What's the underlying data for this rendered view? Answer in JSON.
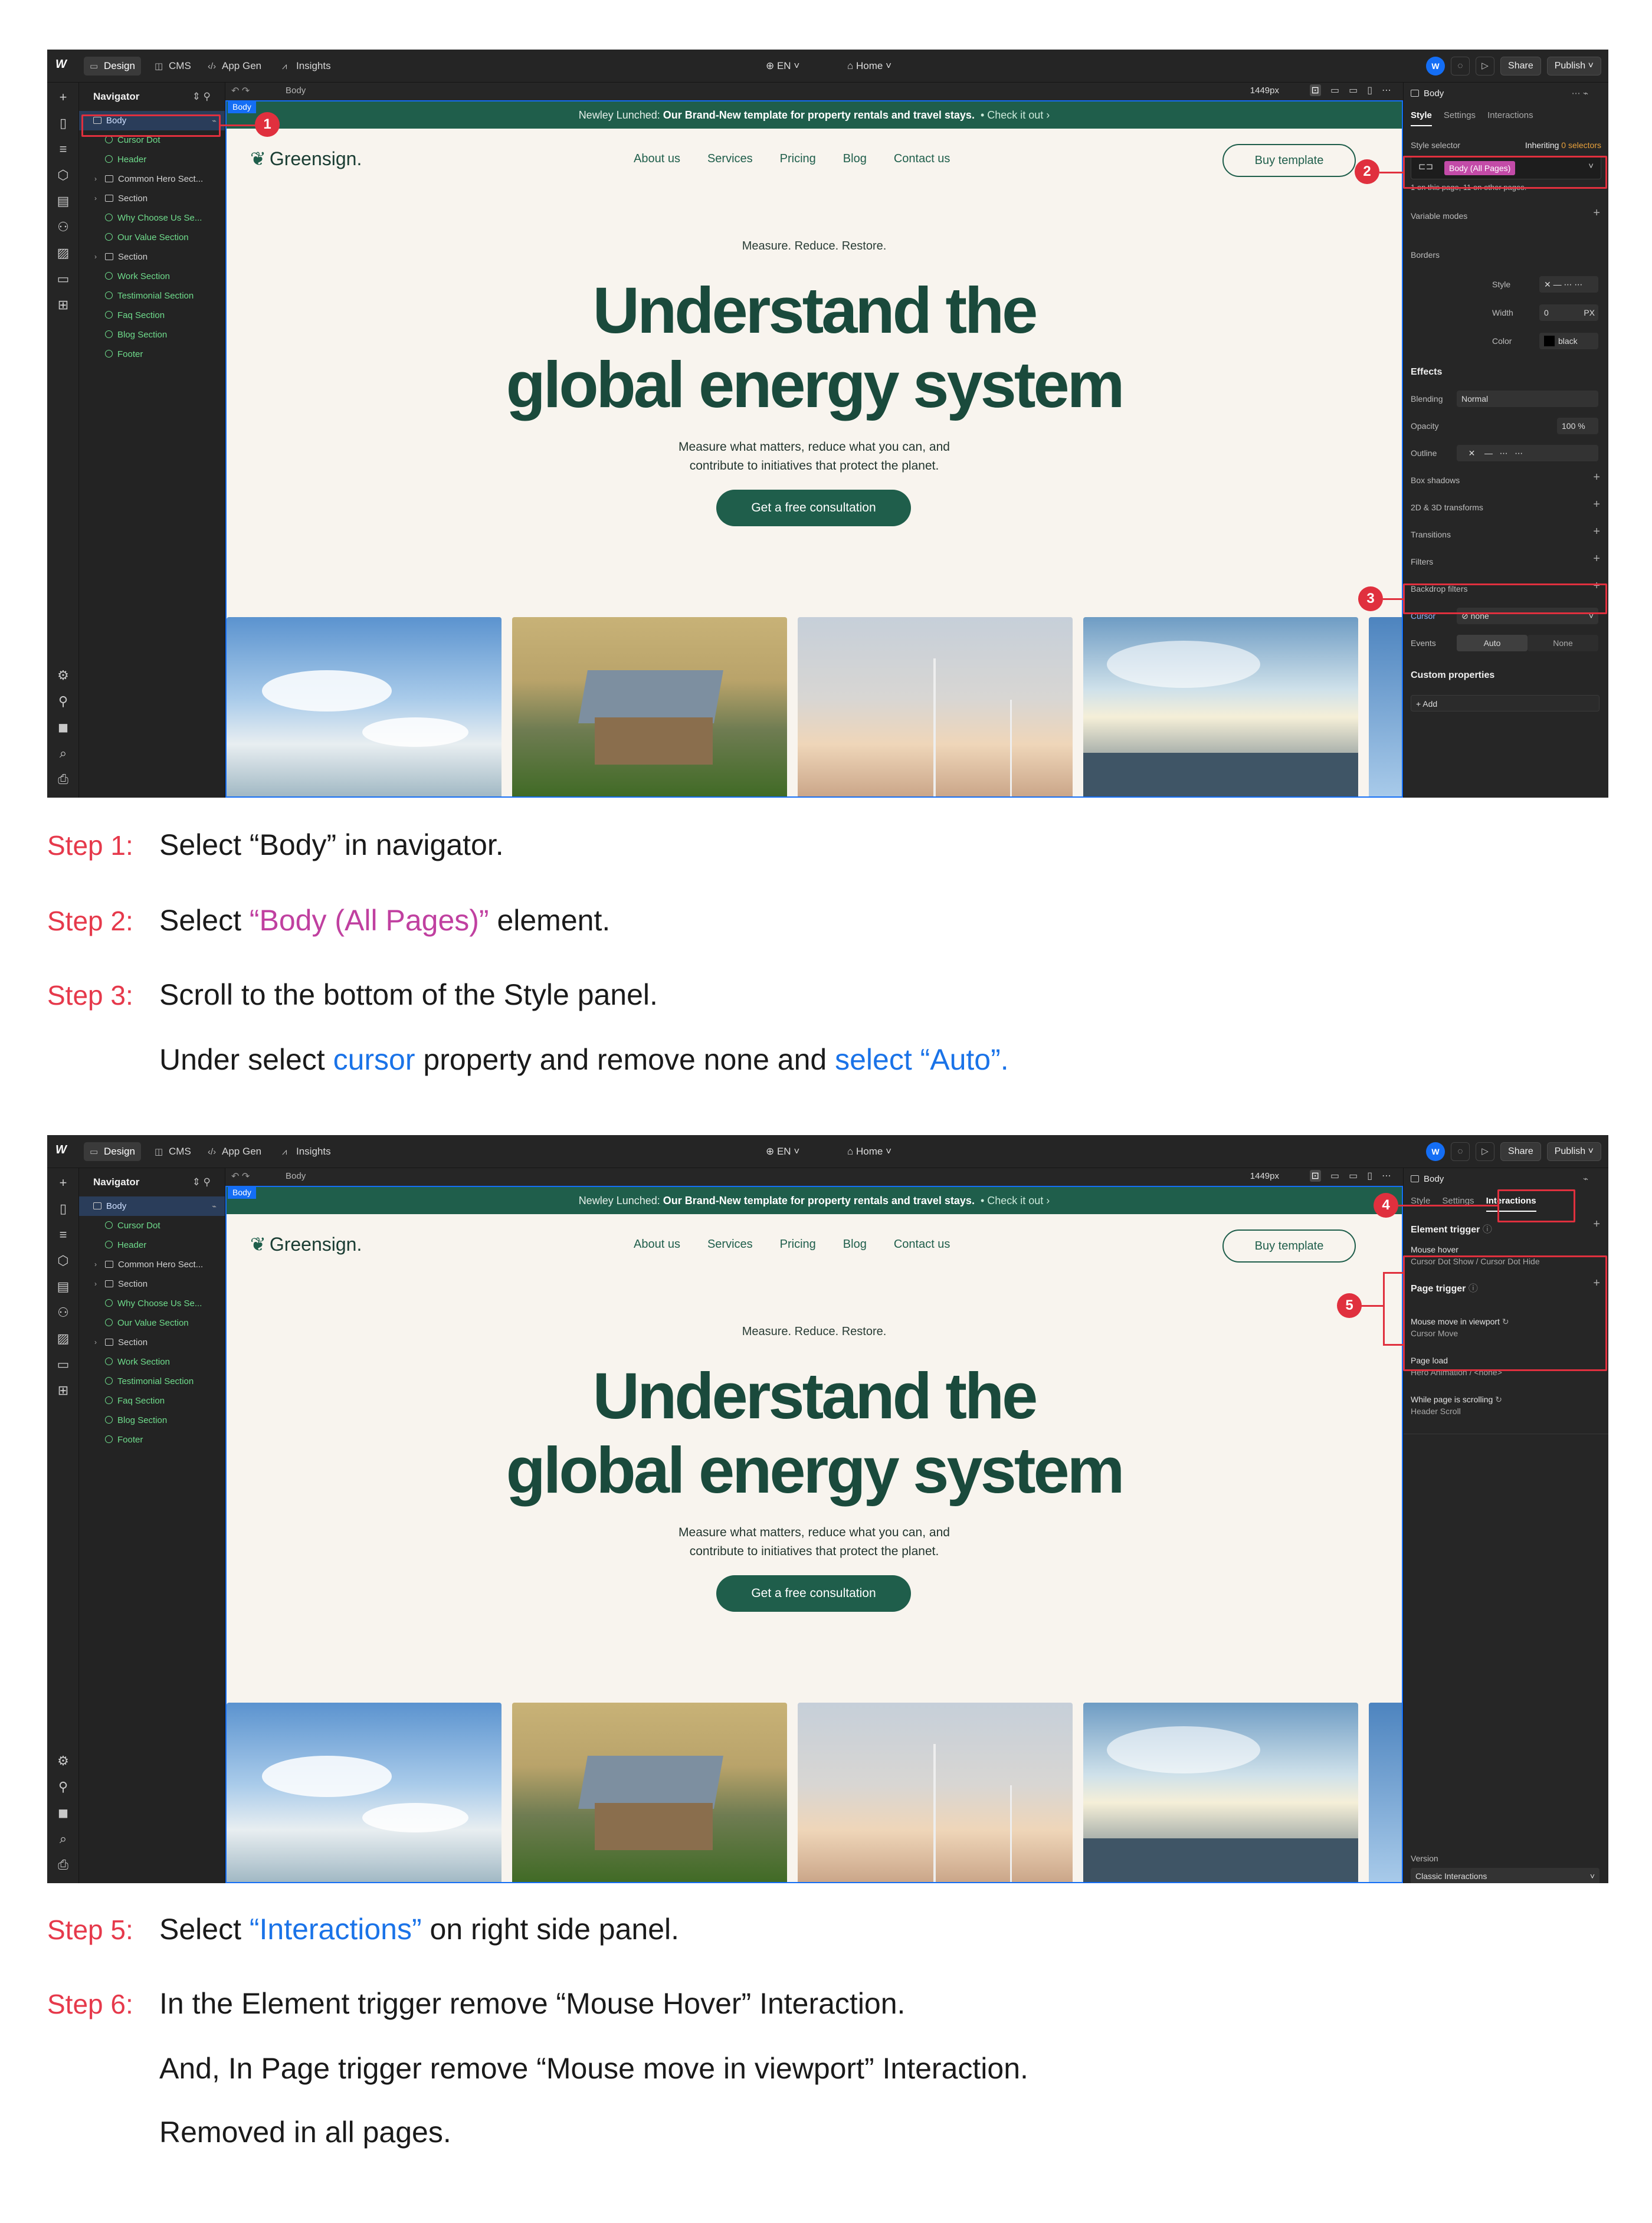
{
  "topbar": {
    "tabs": [
      {
        "label": "Design",
        "icon": "design-icon"
      },
      {
        "label": "CMS",
        "icon": "database-icon"
      },
      {
        "label": "App Gen",
        "icon": "code-icon"
      },
      {
        "label": "Insights",
        "icon": "chart-icon"
      }
    ],
    "locale": "EN",
    "page": "Home",
    "avatar": "W",
    "share": "Share",
    "publish": "Publish"
  },
  "navigator": {
    "title": "Navigator",
    "items": [
      {
        "label": "Body",
        "kind": "box"
      },
      {
        "label": "Cursor Dot",
        "kind": "symbol"
      },
      {
        "label": "Header",
        "kind": "symbol"
      },
      {
        "label": "Common Hero Sect...",
        "kind": "box"
      },
      {
        "label": "Section",
        "kind": "box"
      },
      {
        "label": "Why Choose Us Se...",
        "kind": "symbol"
      },
      {
        "label": "Our Value Section",
        "kind": "symbol"
      },
      {
        "label": "Section",
        "kind": "box"
      },
      {
        "label": "Work Section",
        "kind": "symbol"
      },
      {
        "label": "Testimonial Section",
        "kind": "symbol"
      },
      {
        "label": "Faq Section",
        "kind": "symbol"
      },
      {
        "label": "Blog Section",
        "kind": "symbol"
      },
      {
        "label": "Footer",
        "kind": "symbol"
      }
    ]
  },
  "canvas": {
    "breadcrumb": "Body",
    "width_readout": "1449px",
    "body_tag": "Body"
  },
  "site": {
    "announcement_prefix": "Newley Lunched:",
    "announcement_bold": "Our Brand-New template for property rentals and travel stays.",
    "announcement_cta": "•  Check it out ›",
    "brand": "Greensign.",
    "menu": [
      "About us",
      "Services",
      "Pricing",
      "Blog",
      "Contact us"
    ],
    "buy_button": "Buy template",
    "kicker": "Measure. Reduce. Restore.",
    "title_line1": "Understand the",
    "title_line2": "global energy system",
    "subtitle_line1": "Measure what matters, reduce what you can, and",
    "subtitle_line2": "contribute to initiatives that protect the planet.",
    "cta": "Get a free consultation"
  },
  "style_panel": {
    "element": "Body",
    "tabs": [
      "Style",
      "Settings",
      "Interactions"
    ],
    "selector_label": "Style selector",
    "inheriting": "Inheriting",
    "inheriting_count": "0 selectors",
    "selector_pill": "Body (All Pages)",
    "selector_note": "1 on this page, 11 on other pages.",
    "variable_modes": "Variable modes",
    "borders": "Borders",
    "border_style": "Style",
    "border_width": "Width",
    "border_width_value": "0",
    "border_width_unit": "PX",
    "border_color": "Color",
    "border_color_value": "black",
    "effects": "Effects",
    "blending": "Blending",
    "blending_value": "Normal",
    "opacity": "Opacity",
    "opacity_value": "100",
    "opacity_unit": "%",
    "outline": "Outline",
    "box_shadows": "Box shadows",
    "transforms": "2D & 3D transforms",
    "transitions": "Transitions",
    "filters": "Filters",
    "backdrop_filters": "Backdrop filters",
    "cursor": "Cursor",
    "cursor_value": "none",
    "events": "Events",
    "events_auto": "Auto",
    "events_none": "None",
    "custom_properties": "Custom properties",
    "add": "Add"
  },
  "interactions_panel": {
    "element": "Body",
    "tabs": [
      "Style",
      "Settings",
      "Interactions"
    ],
    "element_trigger": "Element trigger",
    "mouse_hover": "Mouse hover",
    "mouse_hover_detail": "Cursor Dot Show / Cursor Dot Hide",
    "page_trigger": "Page trigger",
    "mouse_move": "Mouse move in viewport",
    "mouse_move_detail": "Cursor Move",
    "page_load": "Page load",
    "page_load_detail": "Hero Animation / <none>",
    "scrolling": "While page is scrolling",
    "scrolling_detail": "Header Scroll",
    "version_label": "Version",
    "version_value": "Classic Interactions"
  },
  "badges": [
    "1",
    "2",
    "3",
    "4",
    "5"
  ],
  "steps": {
    "s1_label": "Step 1:",
    "s1_text": "Select “Body” in navigator.",
    "s2_label": "Step 2:",
    "s2_pre": "Select ",
    "s2_hl": "“Body (All Pages)”",
    "s2_post": " element.",
    "s3_label": "Step 3:",
    "s3_text": "Scroll to the bottom of the Style panel.",
    "s3b_pre": "Under select ",
    "s3b_hl1": "cursor",
    "s3b_mid": " property and remove none and ",
    "s3b_hl2": "select “Auto”.",
    "s5_label": "Step 5:",
    "s5_pre": "Select  ",
    "s5_hl": "“Interactions”",
    "s5_post": " on right side panel.",
    "s6_label": "Step 6:",
    "s6_text": "In the Element trigger remove “Mouse Hover” Interaction.",
    "s6b_text": "And, In Page trigger remove “Mouse move in viewport” Interaction.",
    "s6c_text": "Removed in all pages."
  },
  "colors": {
    "accent": "#146ef5",
    "brand_green": "#1f5e4b",
    "annotation_red": "#e0303e",
    "selector_pink": "#c34ba8"
  }
}
